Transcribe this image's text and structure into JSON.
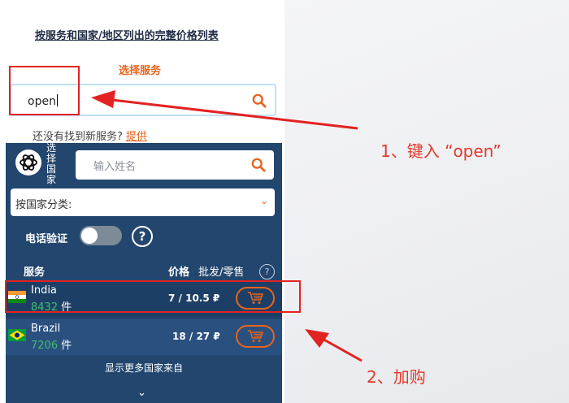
{
  "header": {
    "title_link": "按服务和国家/地区列出的完整价格列表",
    "choose_service": "选择服务"
  },
  "service_search": {
    "value": "open"
  },
  "not_found": {
    "text": "还没有找到新服务?",
    "link": "提供"
  },
  "panel": {
    "vertical_label": "选择国家",
    "search_placeholder": "输入姓名",
    "category_select": "按国家分类:",
    "phone_verify_label": "电话验证",
    "help_symbol": "?",
    "headers": {
      "service": "服务",
      "price": "价格",
      "wholesale_retail": "批发/零售"
    },
    "countries": [
      {
        "name": "India",
        "count": "8432",
        "unit": "件",
        "price": "7 / 10.5 ₽"
      },
      {
        "name": "Brazil",
        "count": "7206",
        "unit": "件",
        "price": "18 / 27 ₽"
      }
    ],
    "show_more": "显示更多国家来自"
  },
  "annotations": {
    "step1": "1、键入 “open”",
    "step2": "2、加购"
  },
  "colors": {
    "panel_bg": "#22466e",
    "accent_orange": "#e8641c",
    "count_green": "#3fbf6d",
    "annotation_red": "#e32222"
  },
  "icons": [
    "search-icon",
    "openai-logo-icon",
    "chevron-down-icon",
    "help-icon",
    "cart-icon",
    "india-flag-icon",
    "brazil-flag-icon",
    "arrow-icon"
  ]
}
